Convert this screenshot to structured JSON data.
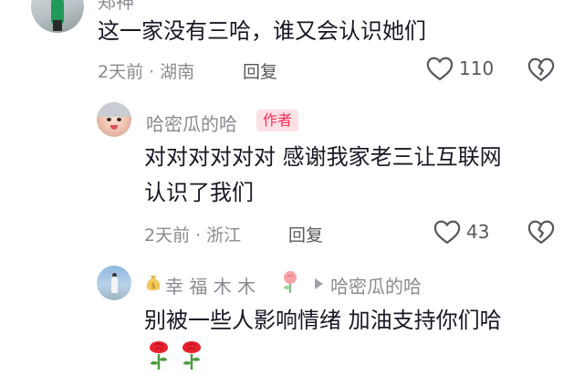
{
  "top_comment": {
    "username_partial": "郑神",
    "text": "这一家没有三哈，谁又会认识她们",
    "time": "2天前",
    "location": "湖南",
    "reply_label": "回复",
    "like_count": "110"
  },
  "author_reply": {
    "username": "哈密瓜的哈",
    "badge": "作者",
    "text_line1": "对对对对对对 感谢我家老三让互联网",
    "text_line2": "认识了我们",
    "time": "2天前",
    "location": "浙江",
    "reply_label": "回复",
    "like_count": "43"
  },
  "nested_reply": {
    "username": "幸 福 木 木",
    "reply_to": "哈密瓜的哈",
    "text": "别被一些人影响情绪  加油支持你们哈"
  },
  "colors": {
    "accent": "#fe2c55",
    "muted": "#8a8b91"
  }
}
